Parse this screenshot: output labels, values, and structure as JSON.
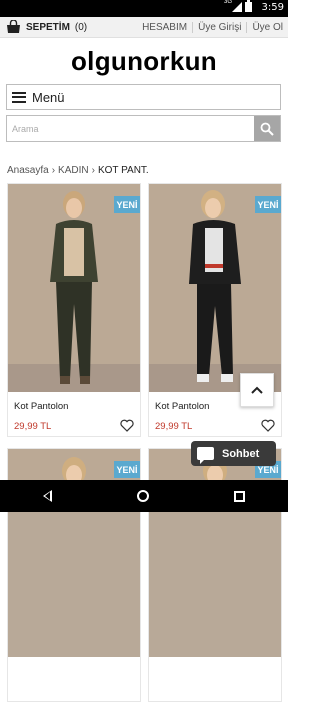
{
  "status_bar": {
    "time": "3:59",
    "network": "3G"
  },
  "top_bar": {
    "cart_label": "SEPETİM",
    "cart_count": "(0)",
    "links": [
      "HESABIM",
      "Üye Girişi",
      "Üye Ol"
    ]
  },
  "logo": "olgunorkun",
  "menu": {
    "label": "Menü"
  },
  "search": {
    "placeholder": "Arama"
  },
  "breadcrumb": [
    "Anasayfa",
    "KADIN",
    "KOT PANT."
  ],
  "products": [
    {
      "badge": "YENİ",
      "name": "Kot Pantolon",
      "price": "29,99 TL"
    },
    {
      "badge": "YENİ",
      "name": "Kot Pantolon",
      "price": "29,99 TL"
    },
    {
      "badge": "YENİ"
    },
    {
      "badge": "YENİ"
    }
  ],
  "chat": {
    "label": "Sohbet"
  },
  "colors": {
    "badge": "#5aa9cf",
    "price": "#c0392b",
    "chat_bg": "#3a3a3a"
  }
}
